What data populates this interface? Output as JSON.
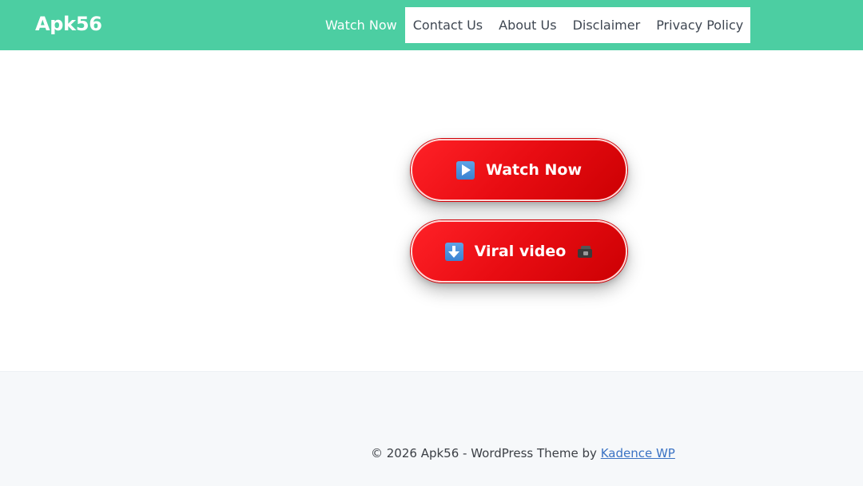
{
  "header": {
    "brand": "Apk56",
    "nav": [
      {
        "label": "Watch Now",
        "active": true
      },
      {
        "label": "Contact Us"
      },
      {
        "label": "About Us"
      },
      {
        "label": "Disclaimer"
      },
      {
        "label": "Privacy Policy"
      }
    ]
  },
  "buttons": {
    "watch_now": {
      "label": "Watch Now",
      "icon": "play-button-emoji-icon"
    },
    "viral_video": {
      "label": "Viral video",
      "icon": "down-arrow-emoji-icon",
      "trailing_icon": "video-camera-icon"
    }
  },
  "footer": {
    "text": "© 2026 Apk56 - WordPress Theme by ",
    "link_label": "Kadence WP"
  },
  "colors": {
    "header_bg": "#4ccea2",
    "button_red": "#e80c12",
    "footer_bg": "#f6f8fa",
    "link": "#3b73c4"
  }
}
